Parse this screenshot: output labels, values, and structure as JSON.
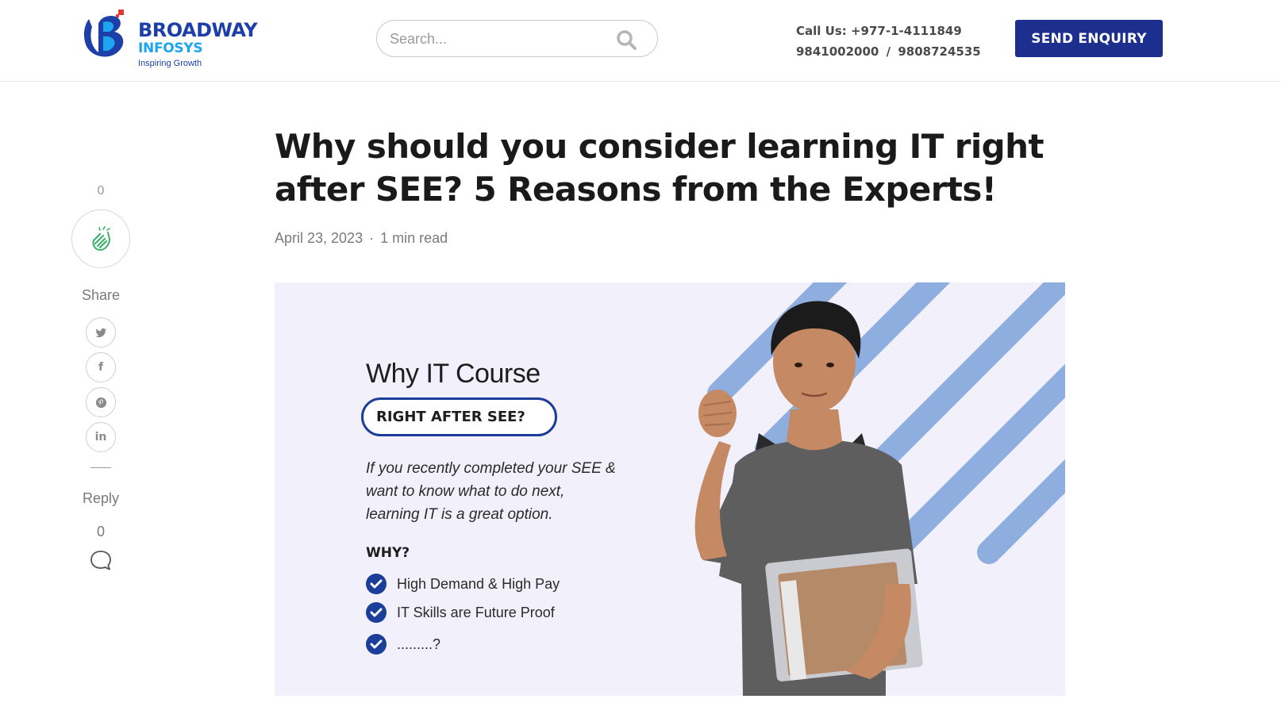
{
  "header": {
    "brand_name": "BROADWAY",
    "brand_sub": "INFOSYS",
    "brand_tagline": "Inspiring Growth",
    "search_placeholder": "Search...",
    "call_label": "Call Us:",
    "call_number": "+977-1-4111849",
    "mobile_1": "9841002000",
    "mobile_sep": "/",
    "mobile_2": "9808724535",
    "enquiry_label": "SEND ENQUIRY"
  },
  "rail": {
    "clap_count": "0",
    "share_label": "Share",
    "social": [
      {
        "icon": "twitter-icon",
        "glyph": "t"
      },
      {
        "icon": "facebook-icon",
        "glyph": "f"
      },
      {
        "icon": "pinterest-icon",
        "glyph": "p"
      },
      {
        "icon": "linkedin-icon",
        "glyph": "in"
      }
    ],
    "reply_label": "Reply",
    "reply_count": "0"
  },
  "article": {
    "title": "Why should you consider learning IT right after SEE? 5 Reasons from the Experts!",
    "date": "April 23, 2023",
    "separator": "·",
    "read_time": "1 min read"
  },
  "hero": {
    "heading": "Why IT Course",
    "pill": "RIGHT AFTER SEE?",
    "paragraph": "If you recently completed your SEE & want to know what to do next, learning IT is a great option.",
    "why_label": "WHY?",
    "reasons": [
      "High Demand & High Pay",
      "IT Skills are Future Proof",
      ".........?"
    ]
  },
  "colors": {
    "brand_dark": "#1d2f8e",
    "brand_blue": "#1d3fa8",
    "brand_light": "#1da5f0",
    "hero_bg": "#f1f0fb",
    "stripe": "#8eaee0"
  }
}
